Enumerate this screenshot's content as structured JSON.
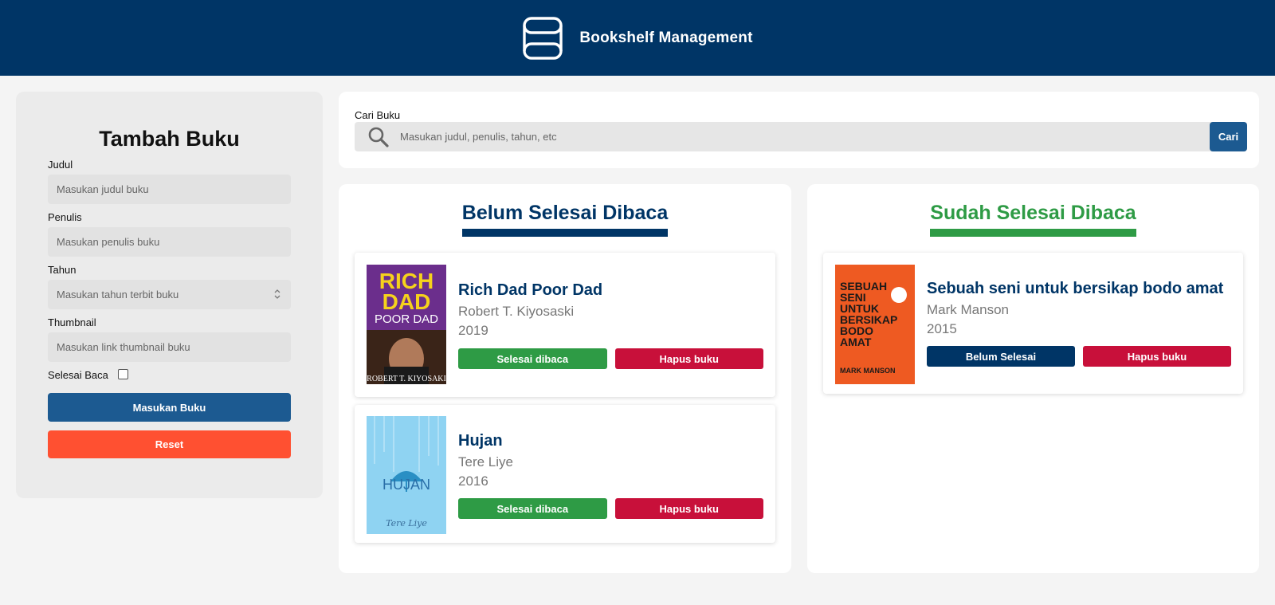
{
  "header": {
    "title": "Bookshelf Management"
  },
  "form": {
    "title": "Tambah Buku",
    "title_label": "Judul",
    "title_placeholder": "Masukan judul buku",
    "author_label": "Penulis",
    "author_placeholder": "Masukan penulis buku",
    "year_label": "Tahun",
    "year_placeholder": "Masukan tahun terbit buku",
    "thumb_label": "Thumbnail",
    "thumb_placeholder": "Masukan link thumbnail buku",
    "complete_label": "Selesai Baca",
    "complete_checked": false,
    "submit_label": "Masukan Buku",
    "reset_label": "Reset"
  },
  "search": {
    "label": "Cari Buku",
    "placeholder": "Masukan judul, penulis, tahun, etc",
    "button_label": "Cari"
  },
  "unread": {
    "title": "Belum Selesai Dibaca",
    "books": [
      {
        "title": "Rich Dad Poor Dad",
        "author": "Robert T. Kiyosaski",
        "year": "2019",
        "action_label": "Selesai dibaca",
        "delete_label": "Hapus buku",
        "cover": {
          "line1": "RICH",
          "line2": "DAD",
          "line3": "POOR DAD",
          "author": "ROBERT T. KIYOSAKI"
        }
      },
      {
        "title": "Hujan",
        "author": "Tere Liye",
        "year": "2016",
        "action_label": "Selesai dibaca",
        "delete_label": "Hapus buku",
        "cover": {
          "line1": "HUJAN",
          "author": "Tere Liye"
        }
      }
    ]
  },
  "read": {
    "title": "Sudah Selesai Dibaca",
    "books": [
      {
        "title": "Sebuah seni untuk bersikap bodo amat",
        "author": "Mark Manson",
        "year": "2015",
        "action_label": "Belum Selesai",
        "delete_label": "Hapus buku",
        "cover": {
          "line1": "SEBUAH",
          "line2": "SENI",
          "line3": "UNTUK",
          "line4": "BERSIKAP",
          "line5": "BODO",
          "line6": "AMAT",
          "author": "MARK MANSON"
        }
      }
    ]
  },
  "colors": {
    "header": "#003566",
    "accent_blue": "#1c5a91",
    "done_green": "#2e9b45",
    "delete_red": "#c8103a",
    "reset_orange": "#ff5031"
  }
}
